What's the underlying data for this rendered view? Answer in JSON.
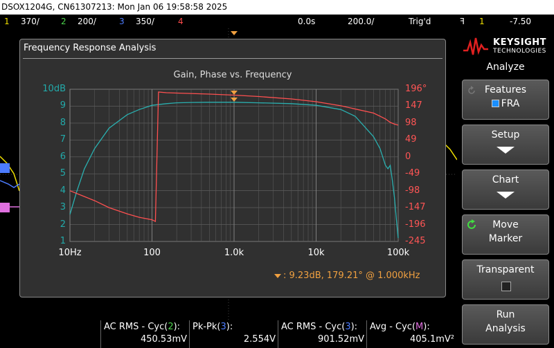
{
  "title_bar": "DSOX1204G, CN61307213: Mon Jan 06 19:58:58 2025",
  "channels": [
    {
      "num": "1",
      "scale": "370/",
      "color": "#f0e000"
    },
    {
      "num": "2",
      "scale": "200/",
      "color": "#4cd44c"
    },
    {
      "num": "3",
      "scale": "350/",
      "color": "#4c7cff"
    },
    {
      "num": "4",
      "scale": "",
      "color": "#ff4c4c"
    }
  ],
  "timebase": {
    "position": "0.0s",
    "scale": "200.0/",
    "mode": "Trig'd"
  },
  "trigger": {
    "symbol": "ꟻ",
    "source": "1",
    "level": "-7.50"
  },
  "dialog": {
    "title": "Frequency Response Analysis",
    "plot_title": "Gain, Phase vs. Frequency",
    "y_left": [
      "10dB",
      "9",
      "8",
      "7",
      "6",
      "5",
      "4",
      "3",
      "2",
      "1"
    ],
    "y_right": [
      "196°",
      "147",
      "98",
      "49",
      "0",
      "-49",
      "-98",
      "-147",
      "-196",
      "-245"
    ],
    "x_labels": [
      "10Hz",
      "100",
      "1.0k",
      "10k",
      "100k"
    ],
    "marker_readout": ": 9.23dB, 179.21° @ 1.000kHz"
  },
  "chart_data": {
    "type": "line",
    "x_scale": "log",
    "xlim": [
      10,
      100000
    ],
    "ylim_left": [
      1,
      10
    ],
    "ylim_right": [
      -245,
      196
    ],
    "grid": true,
    "series": [
      {
        "axis": "left",
        "color": "#2ab0b0",
        "x": [
          10,
          12,
          15,
          20,
          30,
          50,
          70,
          100,
          150,
          200,
          300,
          500,
          700,
          1000,
          2000,
          5000,
          10000,
          20000,
          30000,
          50000,
          60000,
          70000,
          75000,
          80000,
          85000,
          90000,
          95000,
          100000
        ],
        "y": [
          2.6,
          3.9,
          5.3,
          6.5,
          7.7,
          8.5,
          8.8,
          9.05,
          9.15,
          9.2,
          9.22,
          9.23,
          9.23,
          9.23,
          9.2,
          9.15,
          9.05,
          8.8,
          8.4,
          7.2,
          6.5,
          5.5,
          5.3,
          5.5,
          4.6,
          3.6,
          2.3,
          1.2
        ]
      },
      {
        "axis": "right",
        "color": "#ff5050",
        "x": [
          10,
          15,
          20,
          30,
          50,
          70,
          100,
          110,
          120,
          150,
          200,
          500,
          1000,
          2000,
          5000,
          10000,
          20000,
          50000,
          60000,
          70000,
          80000,
          90000,
          100000
        ],
        "y": [
          -98,
          -115,
          -127,
          -147,
          -165,
          -175,
          -182,
          -187,
          188,
          186,
          185,
          182,
          179,
          175,
          168,
          160,
          148,
          127,
          118,
          110,
          100,
          95,
          92
        ]
      }
    ],
    "marker_x": 1000
  },
  "measurements": [
    {
      "label_pre": "AC RMS - Cyc(",
      "label_ch": "2",
      "label_post": "):",
      "value": "450.53mV",
      "ch_color": "#4cd44c"
    },
    {
      "label_pre": "Pk-Pk(",
      "label_ch": "3",
      "label_post": "):",
      "value": "2.554V",
      "ch_color": "#4c7cff"
    },
    {
      "label_pre": "AC RMS - Cyc(",
      "label_ch": "3",
      "label_post": "):",
      "value": "901.52mV",
      "ch_color": "#4c7cff"
    },
    {
      "label_pre": "Avg - Cyc(",
      "label_ch": "M",
      "label_post": "):",
      "value": "405.1mV²",
      "ch_color": "#e070e0"
    }
  ],
  "sidebar": {
    "brand": "KEYSIGHT",
    "brand_sub": "TECHNOLOGIES",
    "menu_title": "Analyze",
    "buttons": [
      {
        "line1": "Features",
        "line2": "FRA"
      },
      {
        "line1": "Setup",
        "line2": ""
      },
      {
        "line1": "Chart",
        "line2": ""
      },
      {
        "line1": "Move",
        "line2": "Marker"
      },
      {
        "line1": "Transparent",
        "line2": ""
      },
      {
        "line1": "Run",
        "line2": "Analysis"
      }
    ]
  }
}
